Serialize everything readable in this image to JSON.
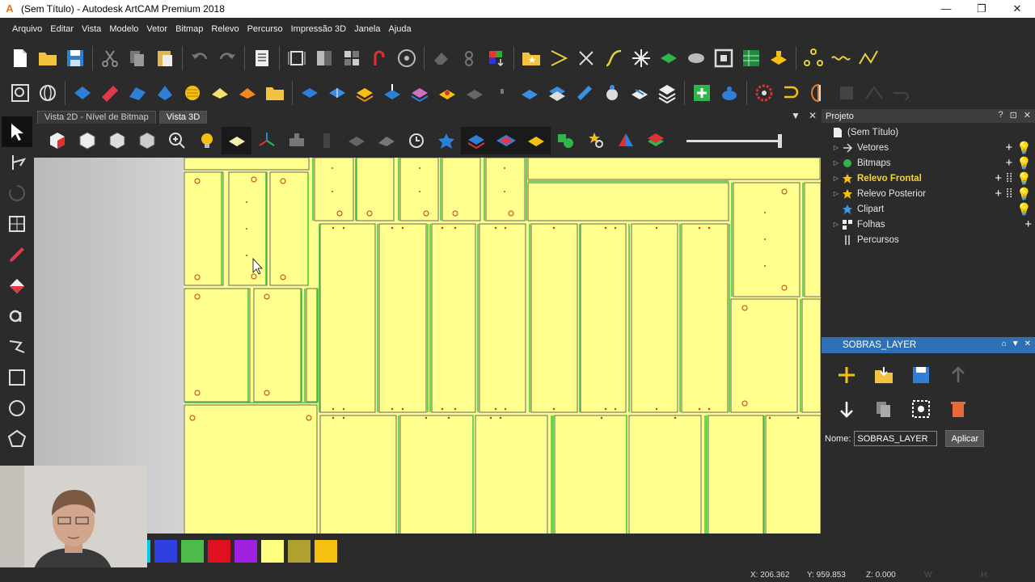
{
  "window": {
    "title": "(Sem Título) - Autodesk ArtCAM Premium 2018",
    "app_icon": "A",
    "minimize": "—",
    "maximize": "❐",
    "close": "✕"
  },
  "menu": [
    "Arquivo",
    "Editar",
    "Vista",
    "Modelo",
    "Vetor",
    "Bitmap",
    "Relevo",
    "Percurso",
    "Impressão 3D",
    "Janela",
    "Ajuda"
  ],
  "view_tabs": [
    {
      "label": "Vista 2D - Nível de Bitmap",
      "active": false
    },
    {
      "label": "Vista 3D",
      "active": true
    }
  ],
  "view_tab_controls": {
    "dropdown": "▼",
    "close": "✕"
  },
  "project_panel": {
    "title": "Projeto",
    "header_controls": [
      "?",
      "⊡",
      "✕"
    ],
    "items": [
      {
        "label": "(Sem Título)",
        "arrow": "",
        "icon": "document-icon",
        "bold": false,
        "actions": ""
      },
      {
        "label": "Vetores",
        "arrow": "▷",
        "icon": "vectors-icon",
        "bold": false,
        "actions": "+ 💡"
      },
      {
        "label": "Bitmaps",
        "arrow": "▷",
        "icon": "bitmaps-icon",
        "bold": false,
        "actions": "+ 💡"
      },
      {
        "label": "Relevo Frontal",
        "arrow": "▷",
        "icon": "star-icon",
        "bold": true,
        "actions": "+ ⋮⋮ 💡"
      },
      {
        "label": "Relevo Posterior",
        "arrow": "▷",
        "icon": "star-icon",
        "bold": false,
        "actions": "+ ⋮⋮ 💡"
      },
      {
        "label": "Clipart",
        "arrow": "",
        "icon": "clipart-star-icon",
        "bold": false,
        "actions": "💡"
      },
      {
        "label": "Folhas",
        "arrow": "▷",
        "icon": "sheets-icon",
        "bold": false,
        "actions": "+"
      },
      {
        "label": "Percursos",
        "arrow": "",
        "icon": "toolpaths-icon",
        "bold": false,
        "actions": ""
      }
    ]
  },
  "layer_panel": {
    "title": "SOBRAS_LAYER",
    "header_controls": [
      "⌂",
      "▼",
      "✕"
    ],
    "name_label": "Nome:",
    "name_value": "SOBRAS_LAYER",
    "apply_label": "Aplicar"
  },
  "palette": {
    "colors": [
      "#00c8e8",
      "#2f3fe0",
      "#4cbb4c",
      "#e01020",
      "#a020e0",
      "#ffff80",
      "#b0a030",
      "#f5c010"
    ]
  },
  "status": {
    "x": "X: 206.362",
    "y": "Y: 959.853",
    "z": "Z: 0.000",
    "w": "W:",
    "h": "H:"
  },
  "colors": {
    "accent": "#2f6fb3",
    "material": "#ffff8e",
    "vector_green": "#33cc33",
    "hole_red": "#cc3322"
  }
}
